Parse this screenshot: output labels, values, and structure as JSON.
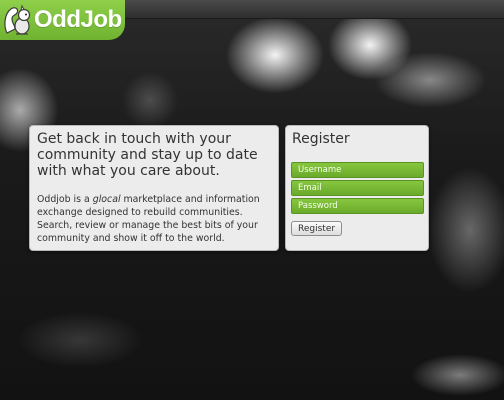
{
  "brand": {
    "name": "OddJob",
    "logo_icon": "squirrel-icon",
    "accent": "#7ec03c"
  },
  "intro": {
    "heading": "Get back in touch with your community and stay up to date with what you care about.",
    "body_prefix": "Oddjob is a ",
    "body_emphasis": "glocal",
    "body_suffix": " marketplace and information exchange designed to rebuild communities. Search, review or manage the best bits of your community and show it off to the world."
  },
  "register": {
    "title": "Register",
    "username_placeholder": "Username",
    "email_placeholder": "Email",
    "password_placeholder": "Password",
    "button_label": "Register"
  }
}
